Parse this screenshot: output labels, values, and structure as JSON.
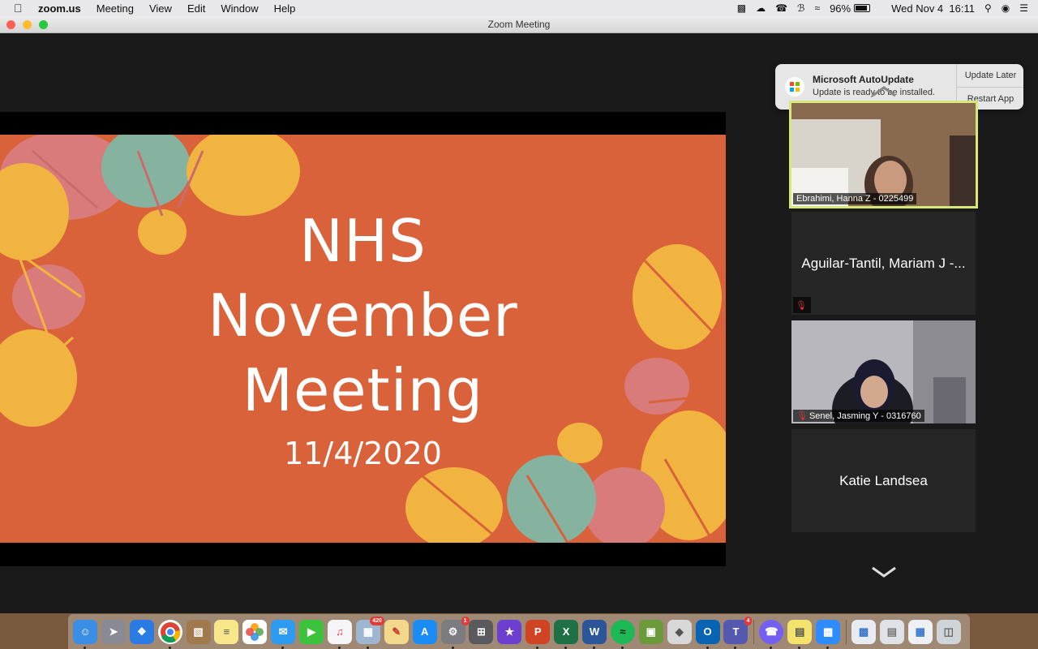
{
  "menubar": {
    "app_name": "zoom.us",
    "menus": [
      "Meeting",
      "View",
      "Edit",
      "Window",
      "Help"
    ],
    "battery": "96%",
    "clock": "Wed Nov 4  16:11"
  },
  "window": {
    "title": "Zoom Meeting"
  },
  "slide": {
    "title": "NHS\nNovember\nMeeting",
    "date": "11/4/2020",
    "background": "#d9623a"
  },
  "notification": {
    "title": "Microsoft AutoUpdate",
    "message": "Update is ready to be installed.",
    "buttons": [
      "Update Later",
      "Restart App"
    ]
  },
  "participants": [
    {
      "name": "Ebrahimi, Hanna Z - 0225499",
      "video": true,
      "active": true,
      "muted": false
    },
    {
      "name": "Aguilar-Tantil, Mariam J -...",
      "video": false,
      "active": false,
      "muted": true
    },
    {
      "name": "Senel, Jasming Y - 0316760",
      "video": true,
      "active": false,
      "muted": true
    },
    {
      "name": "Katie Landsea",
      "video": false,
      "active": false,
      "muted": false
    }
  ],
  "dock": {
    "badges": {
      "preview": "420",
      "system_preferences": "1",
      "teams": "4"
    }
  },
  "colors": {
    "active_speaker_border": "#d7e87a",
    "muted_icon": "#e03434"
  }
}
